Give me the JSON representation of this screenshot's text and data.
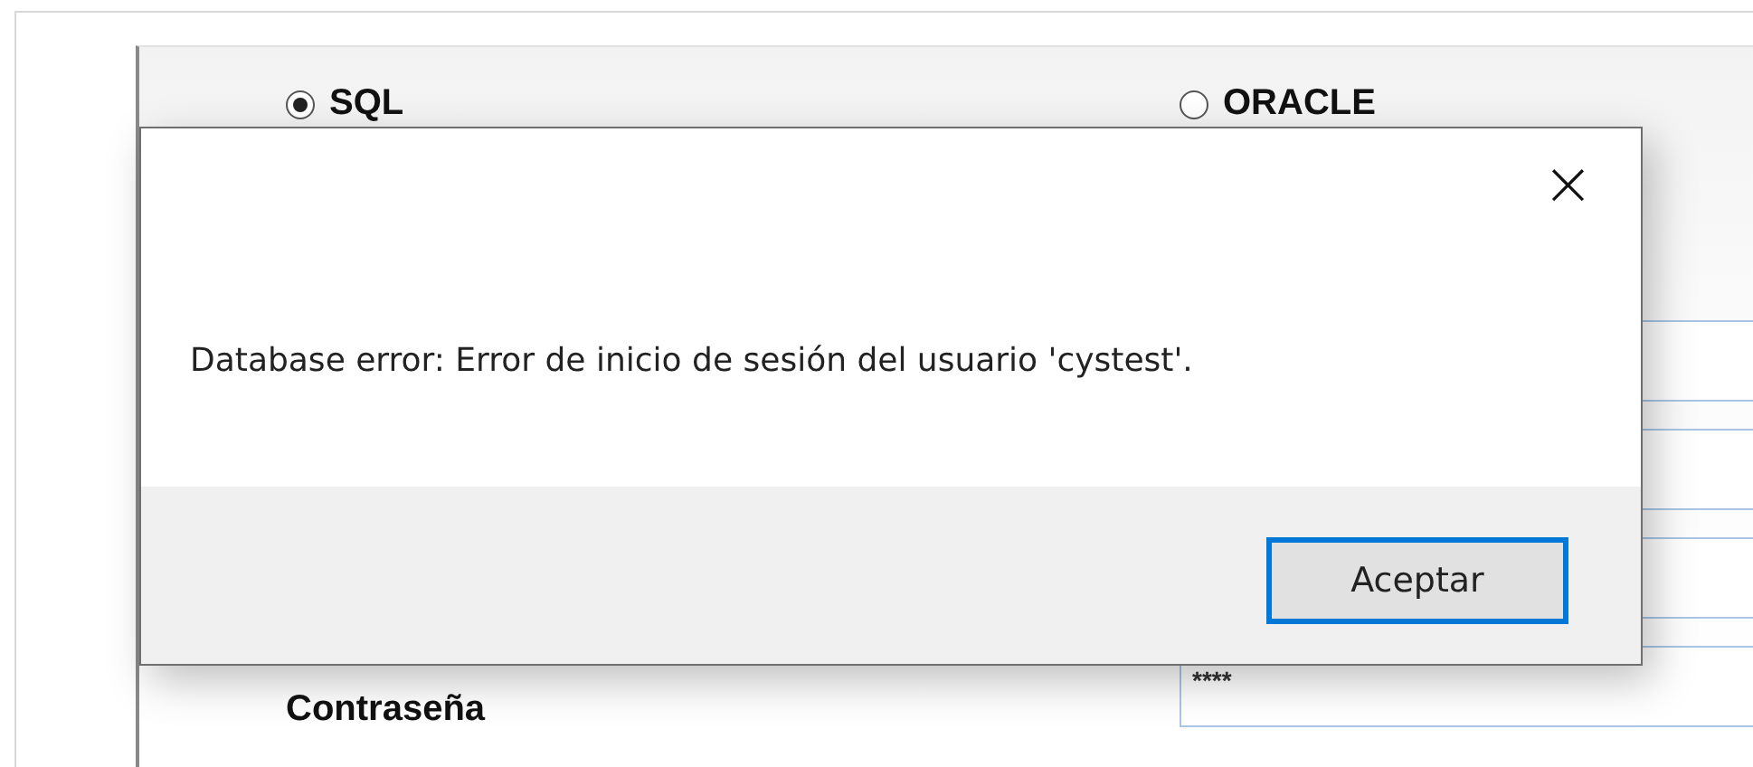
{
  "background_form": {
    "database_options": [
      {
        "label": "SQL",
        "selected": true
      },
      {
        "label": "ORACLE",
        "selected": false
      }
    ],
    "password": {
      "label": "Contraseña",
      "value": "****"
    }
  },
  "dialog": {
    "close": "×",
    "message": "Database error: Error de inicio de sesión del usuario 'cystest'.",
    "buttons": [
      {
        "label": "Aceptar",
        "default": true
      }
    ]
  }
}
